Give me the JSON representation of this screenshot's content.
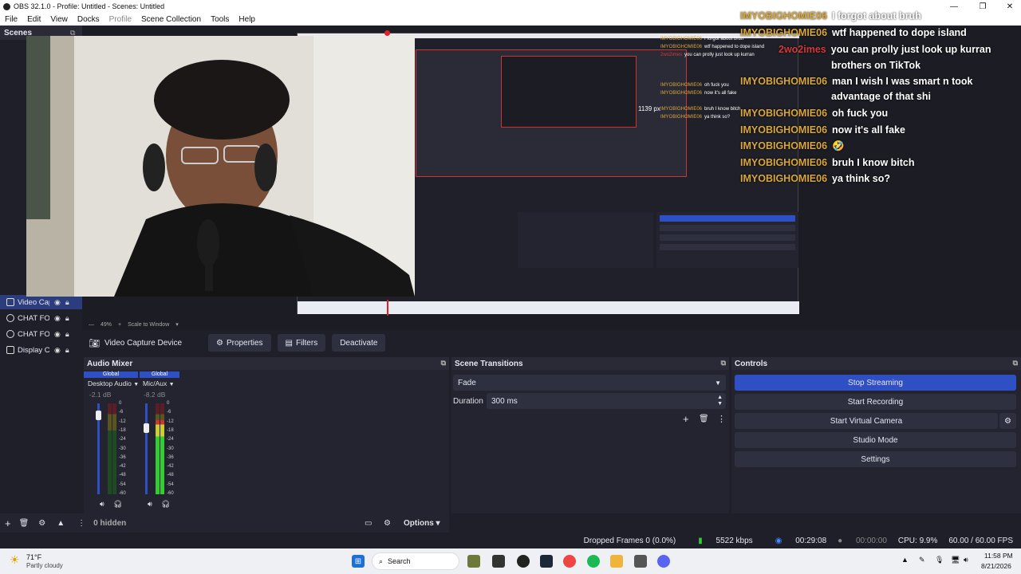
{
  "window": {
    "title": "OBS 32.1.0 - Profile: Untitled - Scenes: Untitled"
  },
  "menu": [
    "File",
    "Edit",
    "View",
    "Docks",
    "Profile",
    "Scene Collection",
    "Tools",
    "Help"
  ],
  "scenes_dock": {
    "title": "Scenes"
  },
  "sources": [
    {
      "label": "Video Cap",
      "icon": "camera-icon",
      "selected": true
    },
    {
      "label": "CHAT FOR",
      "icon": "globe-icon",
      "selected": false
    },
    {
      "label": "CHAT FOR",
      "icon": "globe-icon",
      "selected": false
    },
    {
      "label": "Display Ca",
      "icon": "monitor-icon",
      "selected": false
    }
  ],
  "chat": [
    {
      "user": "IMYOBIGHOMIE06",
      "msg": "I forgot about bruh",
      "red": false
    },
    {
      "user": "IMYOBIGHOMIE06",
      "msg": "wtf happened to dope island",
      "red": false
    },
    {
      "user": "2wo2imes",
      "msg": "you can prolly just look up kurran",
      "red": true
    },
    {
      "user": "",
      "msg": "brothers on TikTok",
      "red": false
    },
    {
      "user": "IMYOBIGHOMIE06",
      "msg": "man I wish I was smart n took",
      "red": false
    },
    {
      "user": "",
      "msg": "advantage of that shi",
      "red": false
    },
    {
      "user": "IMYOBIGHOMIE06",
      "msg": "oh fuck you",
      "red": false
    },
    {
      "user": "IMYOBIGHOMIE06",
      "msg": "now it's all fake",
      "red": false
    },
    {
      "user": "IMYOBIGHOMIE06",
      "msg": "🤣",
      "red": false
    },
    {
      "user": "IMYOBIGHOMIE06",
      "msg": "bruh I know bitch",
      "red": false
    },
    {
      "user": "IMYOBIGHOMIE06",
      "msg": "ya think so?",
      "red": false
    }
  ],
  "preview": {
    "size_label": "1139 px",
    "zoom": "49%",
    "scale_mode": "Scale to Window"
  },
  "source_toolbar": {
    "name": "Video Capture Device",
    "properties": "Properties",
    "filters": "Filters",
    "deactivate": "Deactivate"
  },
  "audio_mixer": {
    "title": "Audio Mixer",
    "channels": [
      {
        "tag": "Global",
        "name": "Desktop Audio",
        "db": "-2.1 dB",
        "level": 0.0,
        "fader": 0.92
      },
      {
        "tag": "Global",
        "name": "Mic/Aux",
        "db": "-8.2 dB",
        "level": 0.82,
        "fader": 0.78
      }
    ],
    "scale": [
      "0",
      "-6",
      "-12",
      "-18",
      "-24",
      "-30",
      "-36",
      "-42",
      "-48",
      "-54",
      "-60"
    ]
  },
  "transitions": {
    "title": "Scene Transitions",
    "selected": "Fade",
    "duration_label": "Duration",
    "duration": "300 ms"
  },
  "controls": {
    "title": "Controls",
    "buttons": [
      "Stop Streaming",
      "Start Recording",
      "Start Virtual Camera",
      "Studio Mode",
      "Settings"
    ]
  },
  "bottom_toolbar": {
    "hidden": "0 hidden",
    "options": "Options"
  },
  "status": {
    "dropped": "Dropped Frames 0 (0.0%)",
    "bitrate": "5522 kbps",
    "stream_time": "00:29:08",
    "rec_time": "00:00:00",
    "cpu": "CPU: 9.9%",
    "fps": "60.00 / 60.00 FPS"
  },
  "taskbar": {
    "weather_temp": "71°F",
    "weather_desc": "Partly cloudy",
    "search": "Search",
    "time": "11:58 PM",
    "date": "8/21/2026"
  },
  "colors": {
    "accent": "#2f4fc4",
    "chat_user": "#d9a63a",
    "chat_user_alt": "#d23a3a"
  }
}
